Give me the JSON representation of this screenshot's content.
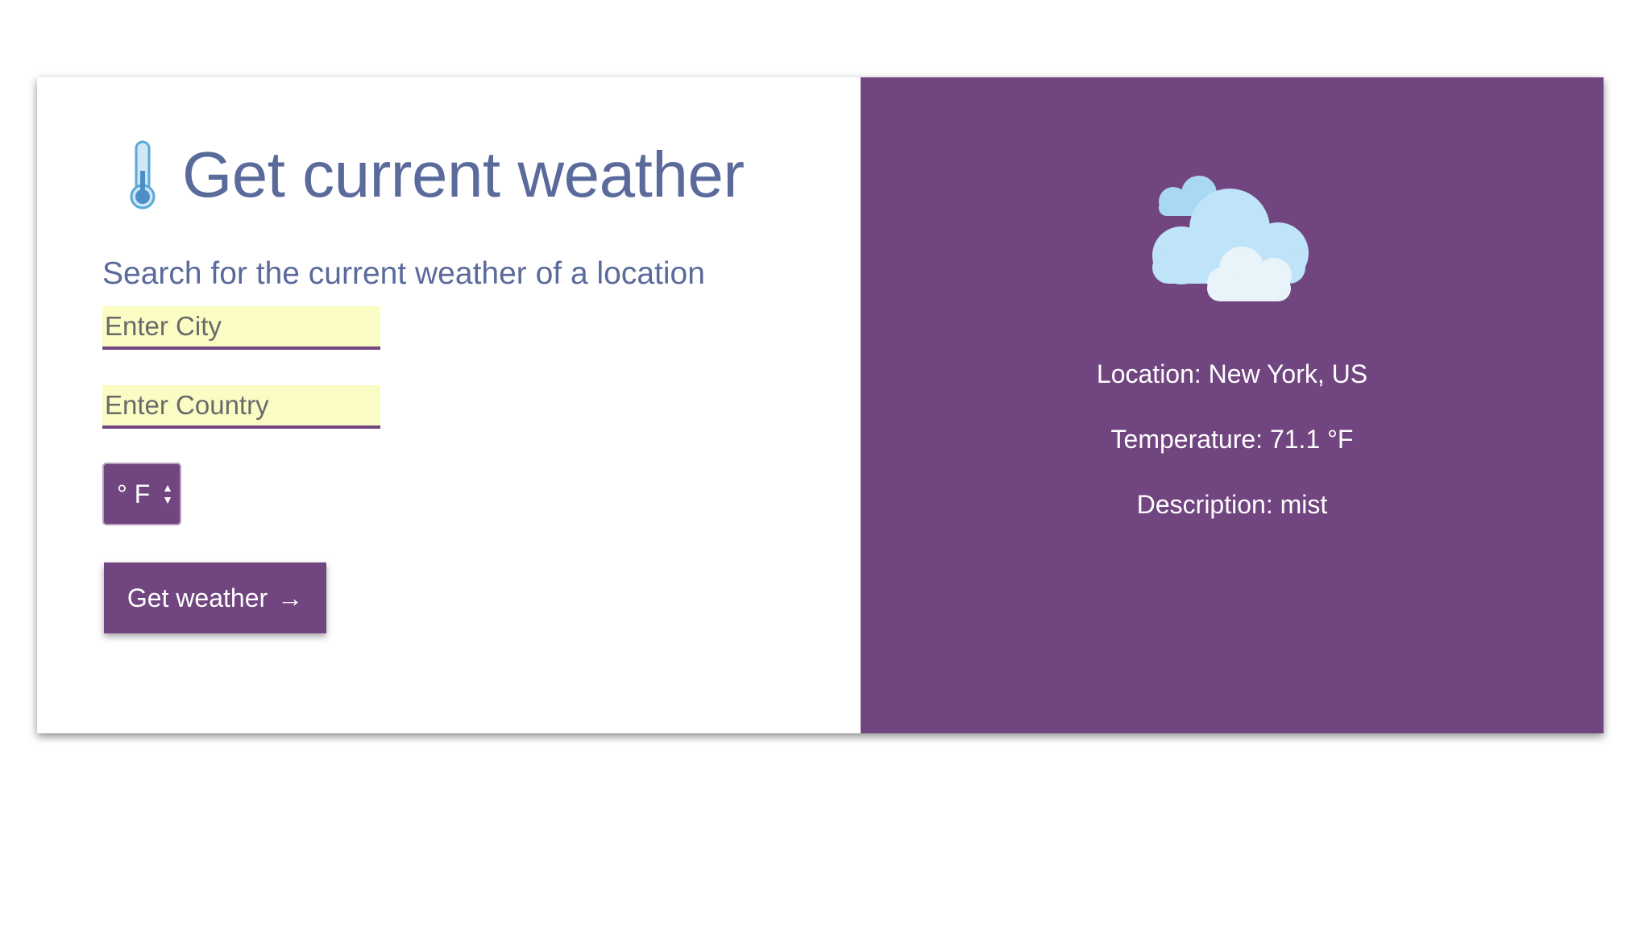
{
  "header": {
    "title": "Get current weather",
    "icon": "thermometer-icon"
  },
  "search": {
    "subtitle": "Search for the current weather of a location",
    "city_placeholder": "Enter City",
    "country_placeholder": "Enter Country",
    "unit_selected": "° F",
    "button_label": "Get weather",
    "button_arrow": "→"
  },
  "result": {
    "icon": "cloudy-icon",
    "location": "Location: New York, US",
    "temperature": "Temperature: 71.1 °F",
    "description": "Description: mist"
  },
  "colors": {
    "accent": "#71457f",
    "title": "#5a6a9b",
    "input_bg": "#fafcc4"
  }
}
